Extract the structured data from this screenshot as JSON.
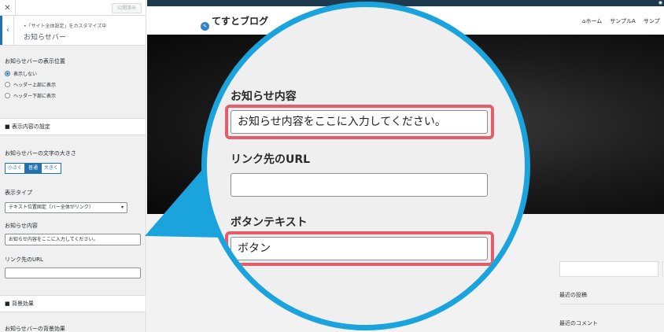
{
  "sidebar": {
    "close_icon": "close-icon",
    "publish_label": "公開済み",
    "back_icon": "chevron-left-icon",
    "breadcrumb": "•「サイト全体設定」をカスタマイズ中",
    "section_title": "お知らせバー",
    "position_label": "お知らせバーの表示位置",
    "position_options": [
      "表示しない",
      "ヘッダー上部に表示",
      "ヘッダー下部に表示"
    ],
    "position_selected": "表示しない",
    "content_settings_head": "■ 表示内容の設定",
    "text_size_label": "お知らせバーの文字の大きさ",
    "size_options": [
      "小さく",
      "普通",
      "大きく"
    ],
    "size_selected": "普通",
    "display_type_label": "表示タイプ",
    "display_type_value": "テキスト位置固定（バー全体がリンク）",
    "notice_content_label": "お知らせ内容",
    "notice_content_value": "お知らせ内容をここに入力してください。",
    "link_url_label": "リンク先のURL",
    "link_url_value": "",
    "bg_effect_head": "■ 背景効果",
    "bg_effect_label": "お知らせバーの背景効果"
  },
  "preview": {
    "site_title": "てすとブログ",
    "edit_icon": "pencil-icon",
    "nav_items": [
      "ホーム",
      "サンプルA",
      "サンプ"
    ],
    "home_icon": "home-icon",
    "rss_icon": "rss-icon",
    "widget_titles": [
      "最近の投稿",
      "最近のコメント"
    ]
  },
  "zoom": {
    "notice_label": "お知らせ内容",
    "notice_value": "お知らせ内容をここに入力してください。",
    "url_label": "リンク先のURL",
    "url_value": "",
    "button_label": "ボタンテキスト",
    "button_value": "ボタン",
    "highlight_color": "#e45d6a",
    "border_color": "#1ba3dd"
  }
}
